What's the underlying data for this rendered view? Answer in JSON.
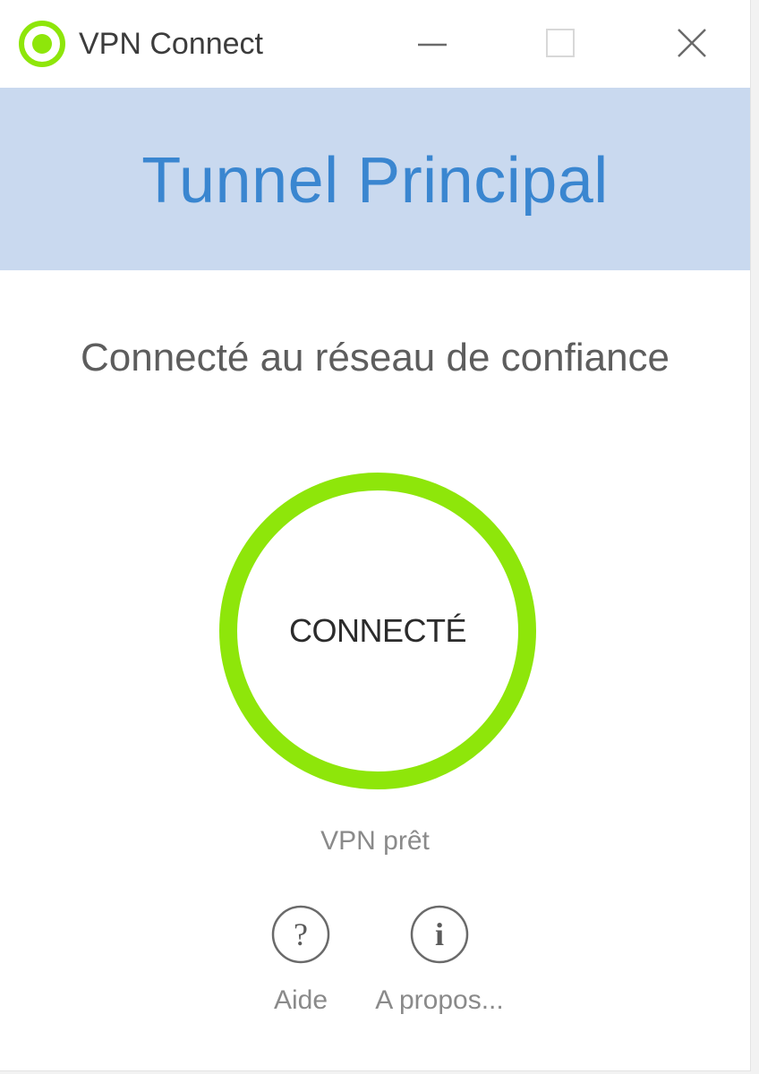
{
  "window": {
    "title": "VPN Connect",
    "controls": {
      "minimize_icon": "minimize-icon",
      "maximize_icon": "maximize-icon",
      "close_icon": "close-icon"
    }
  },
  "header": {
    "profile_name": "Tunnel Principal"
  },
  "status": {
    "message": "Connecté au réseau de confiance",
    "button_label": "CONNECTÉ",
    "ready_text": "VPN prêt"
  },
  "footer": {
    "help": {
      "label": "Aide",
      "icon": "help-icon"
    },
    "about": {
      "label": "A propos...",
      "icon": "info-icon"
    }
  },
  "colors": {
    "accent_green": "#8ee60a",
    "header_bg": "#c9d9ef",
    "header_text": "#3a86d0"
  }
}
